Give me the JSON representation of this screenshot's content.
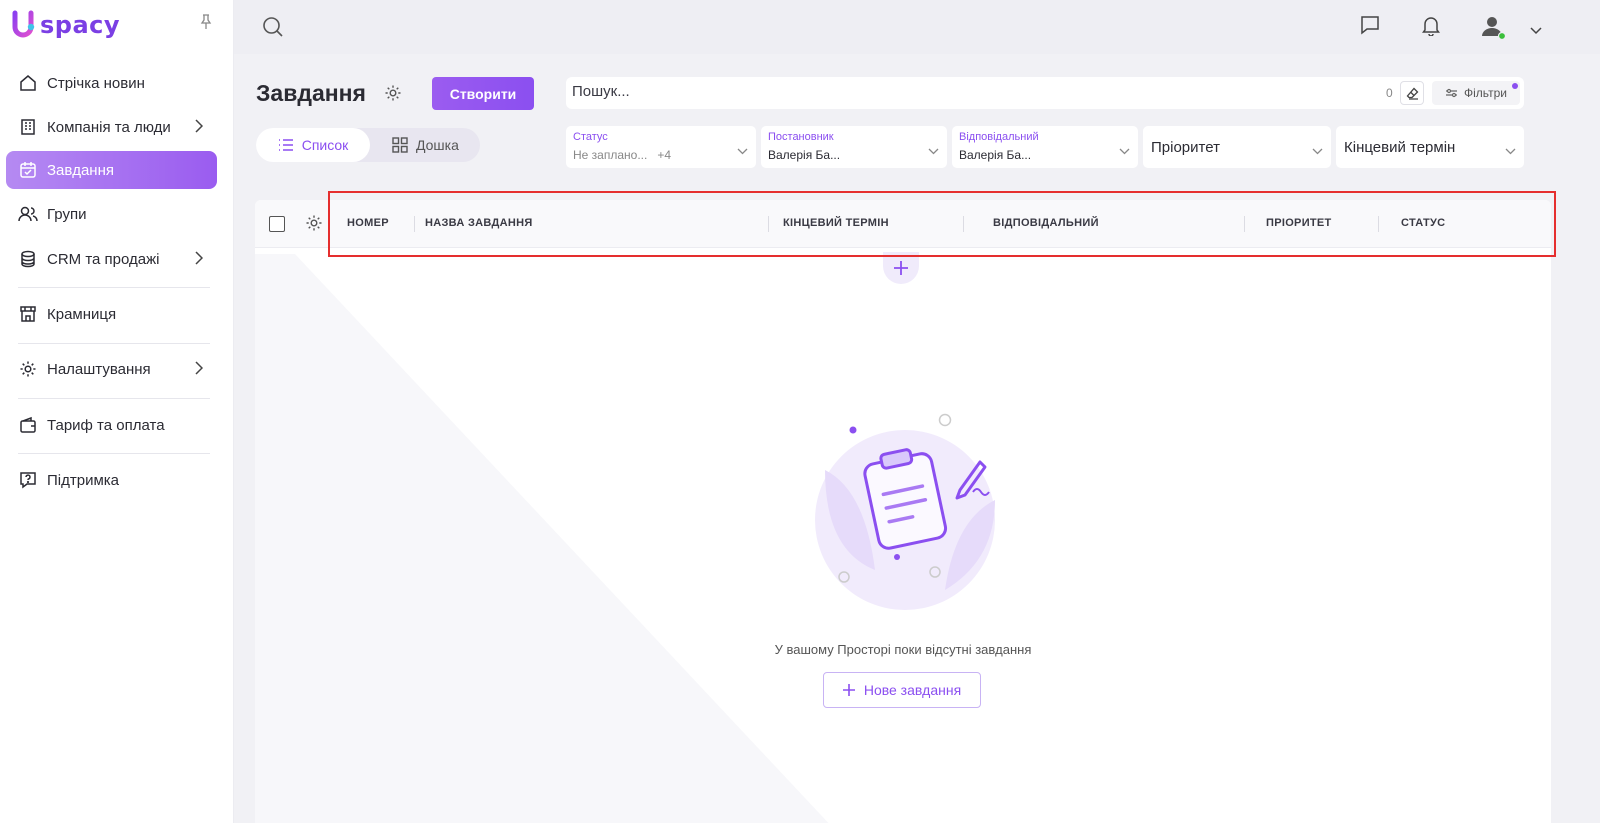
{
  "app": {
    "logo_text": "spacy"
  },
  "sidebar": {
    "items": [
      {
        "label": "Стрічка новин",
        "icon": "home-icon",
        "has_chevron": false
      },
      {
        "label": "Компанія та люди",
        "icon": "building-icon",
        "has_chevron": true
      },
      {
        "label": "Завдання",
        "icon": "calendar-check-icon",
        "has_chevron": false,
        "active": true
      },
      {
        "label": "Групи",
        "icon": "users-icon",
        "has_chevron": false
      },
      {
        "label": "CRM та продажі",
        "icon": "coins-icon",
        "has_chevron": true
      },
      {
        "label": "Крамниця",
        "icon": "store-icon",
        "has_chevron": false
      },
      {
        "label": "Налаштування",
        "icon": "gear-icon",
        "has_chevron": true
      },
      {
        "label": "Тариф та оплата",
        "icon": "wallet-icon",
        "has_chevron": false
      },
      {
        "label": "Підтримка",
        "icon": "help-icon",
        "has_chevron": false
      }
    ]
  },
  "header": {
    "title": "Завдання",
    "create_label": "Створити",
    "view_list_label": "Список",
    "view_board_label": "Дошка"
  },
  "search": {
    "placeholder": "Пошук...",
    "count": "0",
    "filters_label": "Фільтри"
  },
  "filters": {
    "status": {
      "label": "Статус",
      "value": "Не заплано...",
      "extra": "+4"
    },
    "author": {
      "label": "Постановник",
      "value": "Валерія Ба..."
    },
    "responsible": {
      "label": "Відповідальний",
      "value": "Валерія Ба..."
    },
    "priority": {
      "value": "Пріоритет"
    },
    "deadline": {
      "value": "Кінцевий термін"
    }
  },
  "table": {
    "columns": [
      "НОМЕР",
      "НАЗВА ЗАВДАННЯ",
      "КІНЦЕВИЙ ТЕРМІН",
      "ВІДПОВІДАЛЬНИЙ",
      "ПРІОРИТЕТ",
      "СТАТУС"
    ]
  },
  "empty_state": {
    "message": "У вашому Просторі поки відсутні завдання",
    "button_label": "Нове завдання"
  },
  "colors": {
    "accent": "#8b4ff0",
    "highlight": "#e52e2e",
    "online": "#3bbf3b"
  }
}
